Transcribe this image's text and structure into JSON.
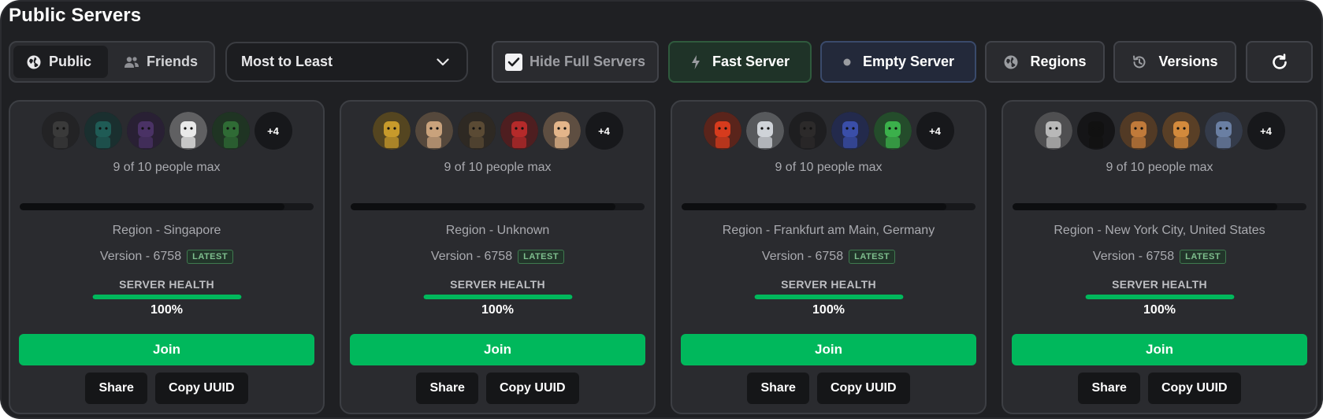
{
  "page": {
    "title": "Public Servers"
  },
  "toolbar": {
    "segmented": [
      {
        "label": "Public",
        "icon": "globe-icon",
        "active": true
      },
      {
        "label": "Friends",
        "icon": "friends-icon",
        "active": false
      }
    ],
    "sort": {
      "value": "Most to Least"
    },
    "hide_full": {
      "label": "Hide Full Servers",
      "checked": true
    },
    "fast_server": {
      "label": "Fast Server",
      "icon": "lightning-icon"
    },
    "empty_server": {
      "label": "Empty Server",
      "icon": "dot-icon"
    },
    "regions": {
      "label": "Regions",
      "icon": "globe-icon"
    },
    "versions": {
      "label": "Versions",
      "icon": "history-icon"
    },
    "refresh": {
      "icon": "refresh-icon"
    }
  },
  "servers": [
    {
      "avatars": [
        "#3a3a3a",
        "#1f5b55",
        "#4a3265",
        "#e9e9e9",
        "#2f6b35"
      ],
      "more": "+4",
      "people": "9 of 10 people max",
      "fill": 0.9,
      "region": "Region - Singapore",
      "version": "Version - 6758",
      "badge": "LATEST",
      "health_label": "SERVER HEALTH",
      "health": "100%",
      "health_fill": 1.0,
      "join": "Join",
      "share": "Share",
      "copy": "Copy UUID"
    },
    {
      "avatars": [
        "#c79a2b",
        "#c9a27c",
        "#5a4a34",
        "#b52a2a",
        "#e3b58a"
      ],
      "more": "+4",
      "people": "9 of 10 people max",
      "fill": 0.9,
      "region": "Region - Unknown",
      "version": "Version - 6758",
      "badge": "LATEST",
      "health_label": "SERVER HEALTH",
      "health": "100%",
      "health_fill": 1.0,
      "join": "Join",
      "share": "Share",
      "copy": "Copy UUID"
    },
    {
      "avatars": [
        "#d63b1d",
        "#cfd3d8",
        "#2c2a2a",
        "#3a4ea8",
        "#3bb04b"
      ],
      "more": "+4",
      "people": "9 of 10 people max",
      "fill": 0.9,
      "region": "Region - Frankfurt am Main, Germany",
      "version": "Version - 6758",
      "badge": "LATEST",
      "health_label": "SERVER HEALTH",
      "health": "100%",
      "health_fill": 1.0,
      "join": "Join",
      "share": "Share",
      "copy": "Copy UUID"
    },
    {
      "avatars": [
        "#b8b8b8",
        "#111111",
        "#c07a3a",
        "#d38a3c",
        "#6a7fa3"
      ],
      "more": "+4",
      "people": "9 of 10 people max",
      "fill": 0.9,
      "region": "Region - New York City, United States",
      "version": "Version - 6758",
      "badge": "LATEST",
      "health_label": "SERVER HEALTH",
      "health": "100%",
      "health_fill": 1.0,
      "join": "Join",
      "share": "Share",
      "copy": "Copy UUID"
    }
  ]
}
